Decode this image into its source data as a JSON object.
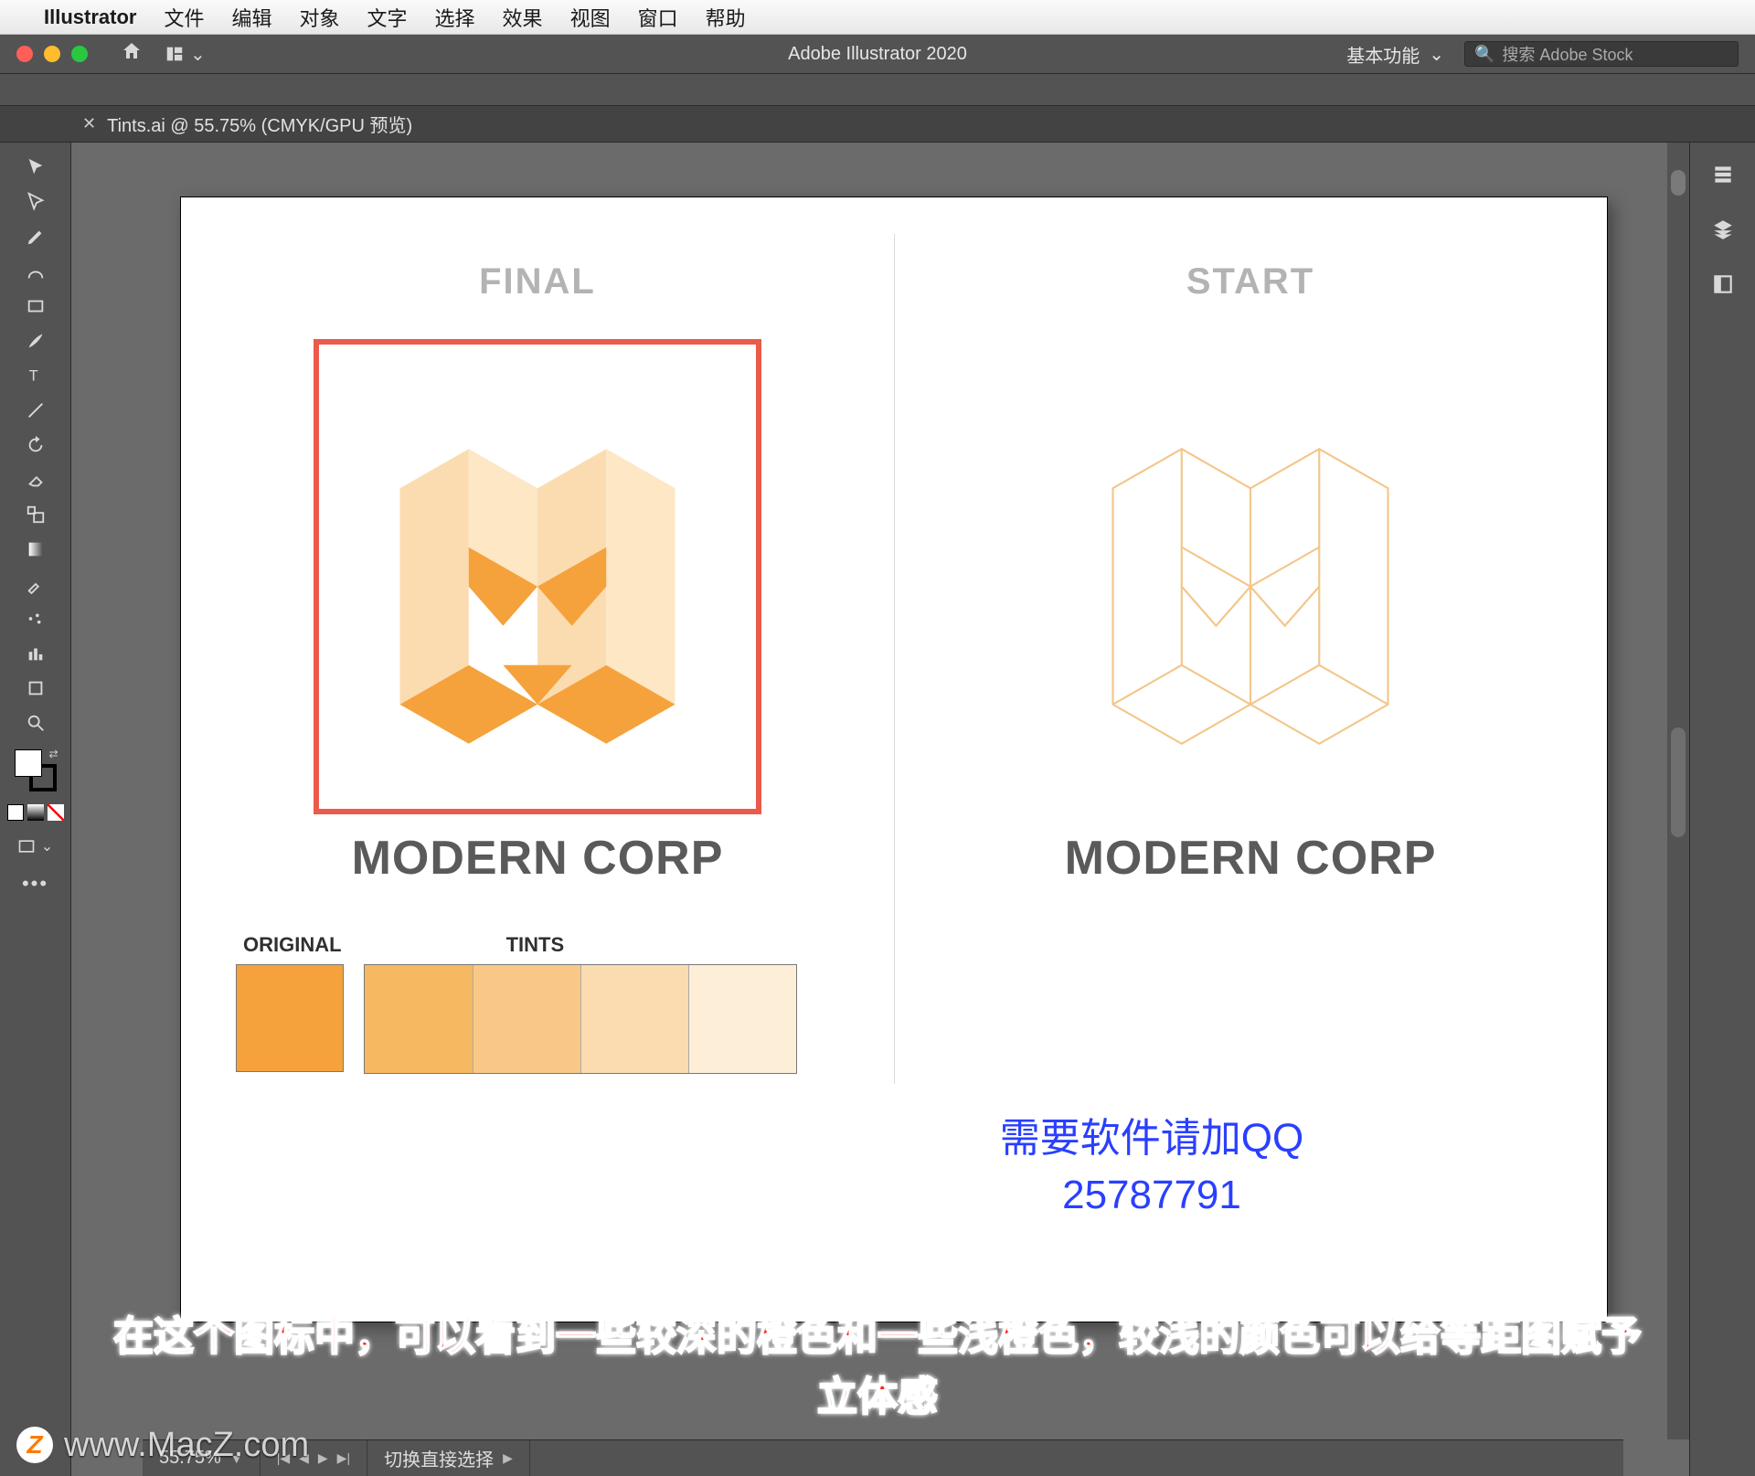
{
  "mac_menu": {
    "app_name": "Illustrator",
    "items": [
      "文件",
      "编辑",
      "对象",
      "文字",
      "选择",
      "效果",
      "视图",
      "窗口",
      "帮助"
    ]
  },
  "titlebar": {
    "app_title": "Adobe Illustrator 2020",
    "workspace_label": "基本功能",
    "search_placeholder": "搜索 Adobe Stock"
  },
  "document_tab": {
    "label": "Tints.ai @ 55.75% (CMYK/GPU 预览)"
  },
  "artboard": {
    "left_heading": "FINAL",
    "right_heading": "START",
    "brand_text": "MODERN CORP",
    "swatch_label_original": "ORIGINAL",
    "swatch_label_tints": "TINTS",
    "colors": {
      "orange": "#f5a23c",
      "tint1": "#f7b862",
      "tint2": "#f9c887",
      "tint3": "#fbdcb1",
      "tint4": "#fdeed8",
      "outline": "#f3c68a",
      "selection": "#eb5a4a"
    }
  },
  "overlay": {
    "qq_line1": "需要软件请加QQ",
    "qq_line2": "25787791",
    "caption_line1": "在这个图标中，可以看到一些较深的橙色和一些浅橙色，较浅的颜色可以给等距图赋予",
    "caption_line2": "立体感",
    "watermark": "www.MacZ.com"
  },
  "statusbar": {
    "zoom": "55.75%",
    "tool_hint": "切换直接选择"
  },
  "tools": [
    "selection",
    "direct-selection",
    "pen",
    "curvature",
    "rectangle",
    "paintbrush",
    "type",
    "line",
    "rotate",
    "eraser",
    "scale",
    "gradient",
    "width",
    "shape-builder",
    "eyedropper",
    "symbol-sprayer",
    "column-graph",
    "artboard",
    "slice",
    "zoom"
  ],
  "panels": [
    "properties",
    "layers",
    "libraries"
  ]
}
